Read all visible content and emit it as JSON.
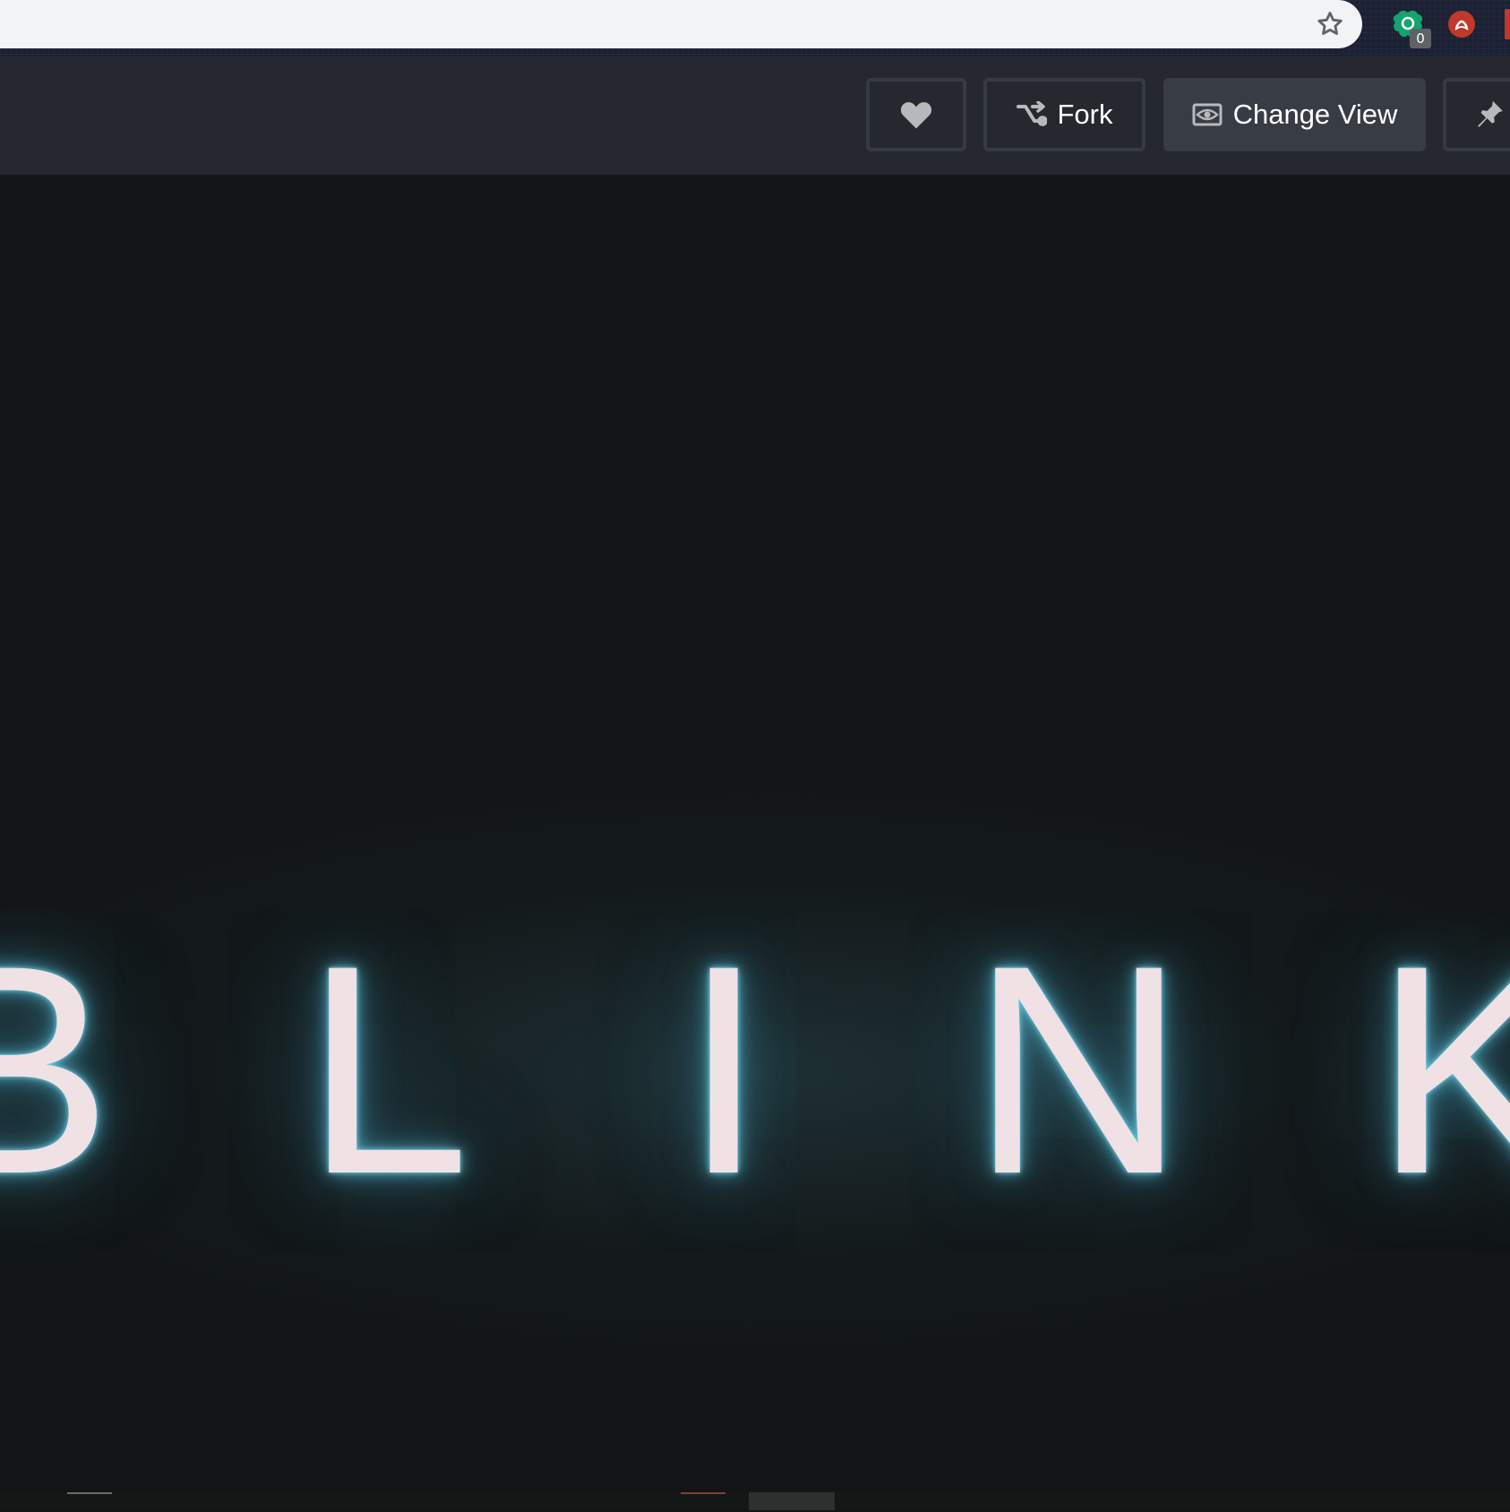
{
  "browser": {
    "star_icon": "bookmark-star-icon",
    "extensions": [
      {
        "name": "grammarly-extension-icon",
        "badge": "0",
        "color": "#15c39a"
      },
      {
        "name": "lastpass-extension-icon",
        "color": "#c0392b"
      }
    ]
  },
  "toolbar": {
    "like_icon": "heart-icon",
    "fork_label": "Fork",
    "fork_icon": "fork-icon",
    "change_view_label": "Change View",
    "change_view_icon": "eye-icon",
    "pin_icon": "pin-icon"
  },
  "preview": {
    "letters": [
      "B",
      "L",
      "I",
      "N",
      "K"
    ],
    "text_color": "#f0e1e5",
    "glow_color": "#5bc4de",
    "background_color": "#121515"
  }
}
